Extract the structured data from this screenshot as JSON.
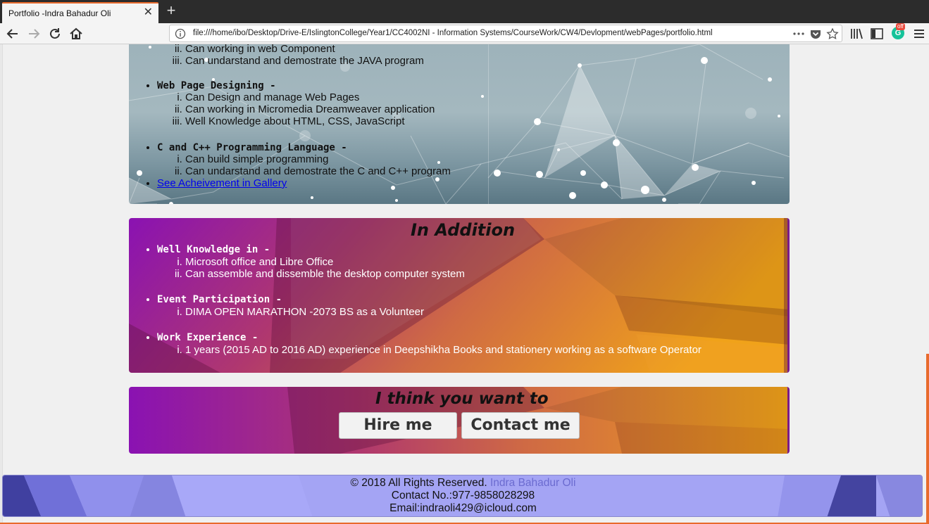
{
  "browser": {
    "tab_title": "Portfolio -Indra Bahadur Oli",
    "url": "file:///home/ibo/Desktop/Drive-E/IslingtonCollege/Year1/CC4002NI - Information Systems/CourseWork/CW4/Devlopment/webPages/portfolio.html",
    "grammarly_badge": "off"
  },
  "skills": {
    "java_items_partial": [
      "Can working in web Component",
      "Can undarstand and demostrate the JAVA program"
    ],
    "web_title": "Web Page Designing -",
    "web_items": [
      "Can Design and manage Web Pages",
      "Can working in Micromedia Dreamweaver application",
      "Well Knowledge about HTML, CSS, JavaScript"
    ],
    "c_title": "C and C++ Programming Language -",
    "c_items": [
      "Can build simple programming",
      "Can undarstand and demostrate the C and C++ program"
    ],
    "gallery_link": "See Acheivement in Gallery"
  },
  "addition": {
    "title": "In Addition",
    "knowledge_title": "Well Knowledge in -",
    "knowledge_items": [
      "Microsoft office and Libre Office",
      "Can assemble and dissemble the desktop computer system"
    ],
    "event_title": "Event Participation -",
    "event_items": [
      "DIMA OPEN MARATHON -2073 BS as a Volunteer"
    ],
    "work_title": "Work Experience -",
    "work_items": [
      "1 years (2015 AD to 2016 AD) experience in Deepshikha Books and stationery working as a software Operator"
    ]
  },
  "hire": {
    "title": "I think you want to",
    "hire_button": "Hire me",
    "contact_button": "Contact me"
  },
  "footer": {
    "copyright": "© 2018 All Rights Reserved.",
    "name": "Indra Bahadur Oli",
    "contact": "Contact No.:977-9858028298",
    "email": "Email:indraoli429@icloud.com"
  }
}
